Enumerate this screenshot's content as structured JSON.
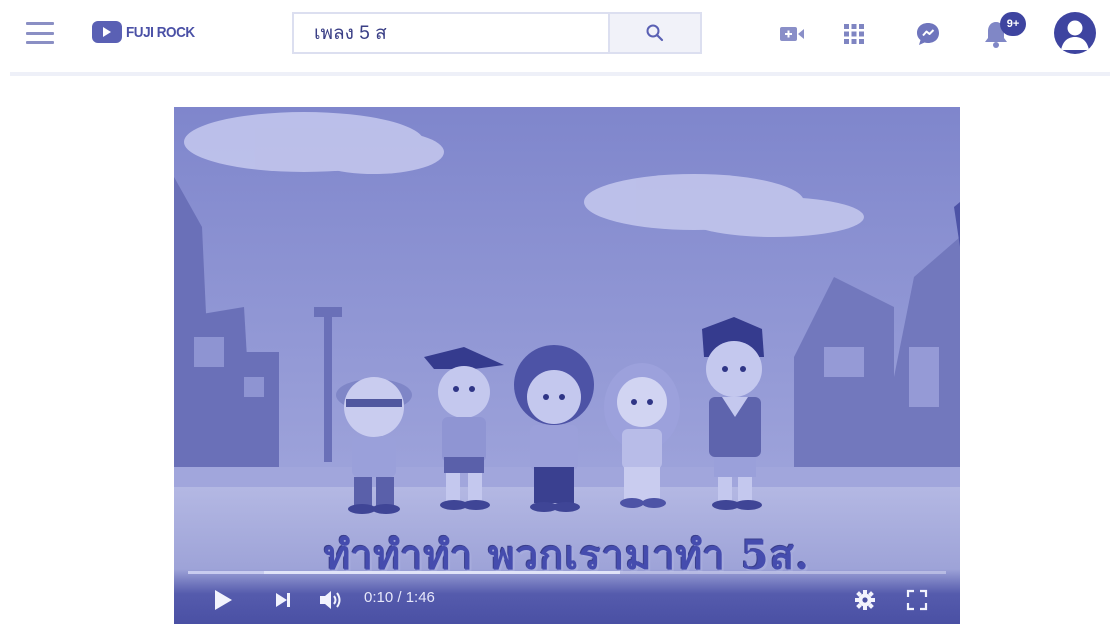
{
  "header": {
    "menu_icon": "hamburger-menu-icon",
    "logo": {
      "icon": "play-logo-icon",
      "text": "FUJI ROCK"
    },
    "search": {
      "value": "เพลง 5 ส",
      "button_icon": "search-icon"
    },
    "actions": [
      {
        "icon": "create-video-icon"
      },
      {
        "icon": "apps-grid-icon"
      },
      {
        "icon": "messages-icon"
      },
      {
        "icon": "notifications-bell-icon",
        "badge": "9+"
      },
      {
        "icon": "account-avatar-icon"
      }
    ]
  },
  "player": {
    "caption": "ทำทำทำ พวกเรามาทำ 5ส.",
    "time_label": "0:10 / 1:46",
    "progress": {
      "played_fraction": 0.1,
      "buffered_fraction": 0.57
    },
    "controls": {
      "play_icon": "play-icon",
      "next_icon": "skip-next-icon",
      "volume_icon": "volume-icon",
      "settings_icon": "settings-gear-icon",
      "fullscreen_icon": "fullscreen-icon"
    }
  },
  "colors": {
    "accent": "#3e44a0",
    "tint": "#8c92cf",
    "control_bar": "#4a50a4"
  }
}
